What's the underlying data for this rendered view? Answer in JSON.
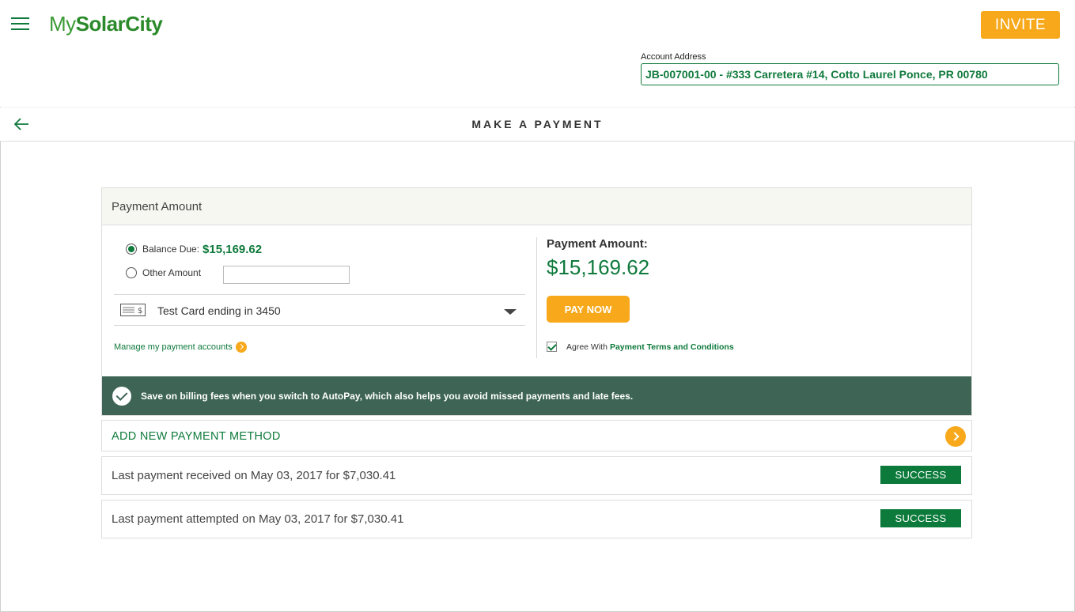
{
  "header": {
    "logo_light": "My",
    "logo_bold": "SolarCity",
    "invite_label": "INVITE",
    "account_label": "Account Address",
    "account_value": "JB-007001-00 - #333 Carretera #14, Cotto Laurel Ponce, PR 00780"
  },
  "titlebar": {
    "title": "MAKE A PAYMENT"
  },
  "payment": {
    "section_title": "Payment Amount",
    "balance_label": "Balance Due:",
    "balance_value": "$15,169.62",
    "other_label": "Other Amount",
    "other_value": "",
    "selected_card": "Test Card ending in 3450",
    "manage_link": "Manage my payment accounts",
    "amount_label": "Payment Amount:",
    "amount_value": "$15,169.62",
    "pay_button": "PAY NOW",
    "agree_prefix": "Agree With",
    "terms_link": "Payment Terms and Conditions",
    "autopay_message": "Save on billing fees when you switch to AutoPay, which also helps you avoid missed payments and late fees."
  },
  "add_method": {
    "label": "ADD NEW PAYMENT METHOD"
  },
  "history": [
    {
      "text": "Last payment received on May 03, 2017 for $7,030.41",
      "status": "SUCCESS"
    },
    {
      "text": "Last payment attempted on May 03, 2017 for $7,030.41",
      "status": "SUCCESS"
    }
  ],
  "colors": {
    "brand_green": "#0f7a3c",
    "accent_orange": "#f7a81b",
    "banner_green": "#3d6454"
  },
  "icons": [
    "menu-icon",
    "back-arrow-icon",
    "card-icon",
    "chevron-down-icon",
    "chevron-right-icon",
    "check-circle-icon"
  ]
}
